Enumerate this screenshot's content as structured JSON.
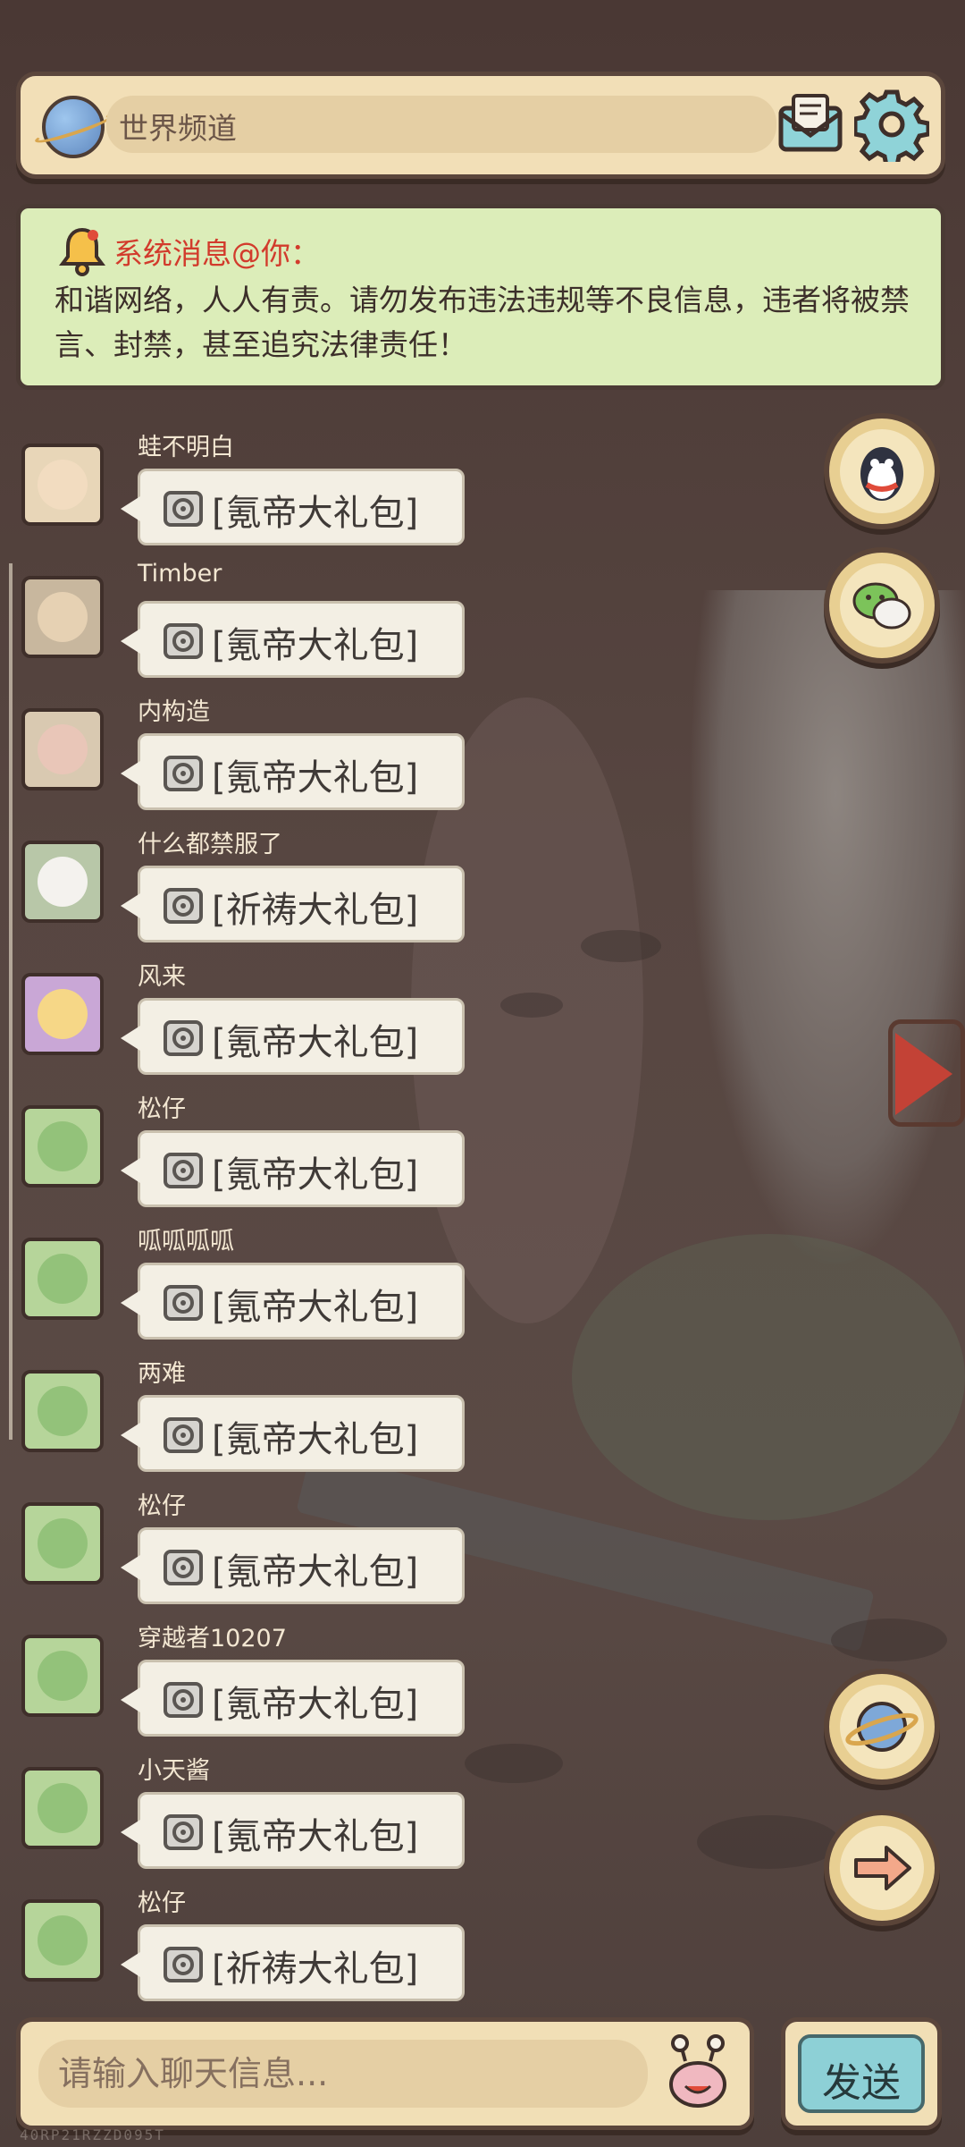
{
  "header": {
    "channel_label": "世界频道"
  },
  "notice": {
    "title": "系统消息@你：",
    "body": "和谐网络，人人有责。请勿发布违法违规等不良信息，违者将被禁言、封禁，甚至追究法律责任！"
  },
  "messages": [
    {
      "user": "蛙不明白",
      "text": "[氪帝大礼包]",
      "avatar": "girl-avatar"
    },
    {
      "user": "Timber",
      "text": "[氪帝大礼包]",
      "avatar": "sunglasses-avatar"
    },
    {
      "user": "内构造",
      "text": "[氪帝大礼包]",
      "avatar": "snail-avatar"
    },
    {
      "user": "什么都禁服了",
      "text": "[祈祷大礼包]",
      "avatar": "panda-avatar"
    },
    {
      "user": "风来",
      "text": "[氪帝大礼包]",
      "avatar": "blonde-avatar"
    },
    {
      "user": "松仔",
      "text": "[氪帝大礼包]",
      "avatar": "frog-avatar"
    },
    {
      "user": "呱呱呱呱",
      "text": "[氪帝大礼包]",
      "avatar": "frog-avatar"
    },
    {
      "user": "两难",
      "text": "[氪帝大礼包]",
      "avatar": "frog-avatar"
    },
    {
      "user": "松仔",
      "text": "[氪帝大礼包]",
      "avatar": "frog-avatar"
    },
    {
      "user": "穿越者10207",
      "text": "[氪帝大礼包]",
      "avatar": "frog-avatar"
    },
    {
      "user": "小天酱",
      "text": "[氪帝大礼包]",
      "avatar": "frog-avatar"
    },
    {
      "user": "松仔",
      "text": "[祈祷大礼包]",
      "avatar": "frog-avatar"
    }
  ],
  "side_buttons": [
    "qq-icon",
    "wechat-icon",
    "planet-icon",
    "arrow-right-icon"
  ],
  "input": {
    "placeholder": "请输入聊天信息..."
  },
  "send_label": "发送",
  "watermark": "40RP21RZZD095T",
  "colors": {
    "notice_bg": "#dcedb9",
    "notice_title": "#d23b2c",
    "panel_bg": "#f2dfb7",
    "send_button": "#8dd0d6",
    "bubble_bg": "#f3efe4"
  }
}
